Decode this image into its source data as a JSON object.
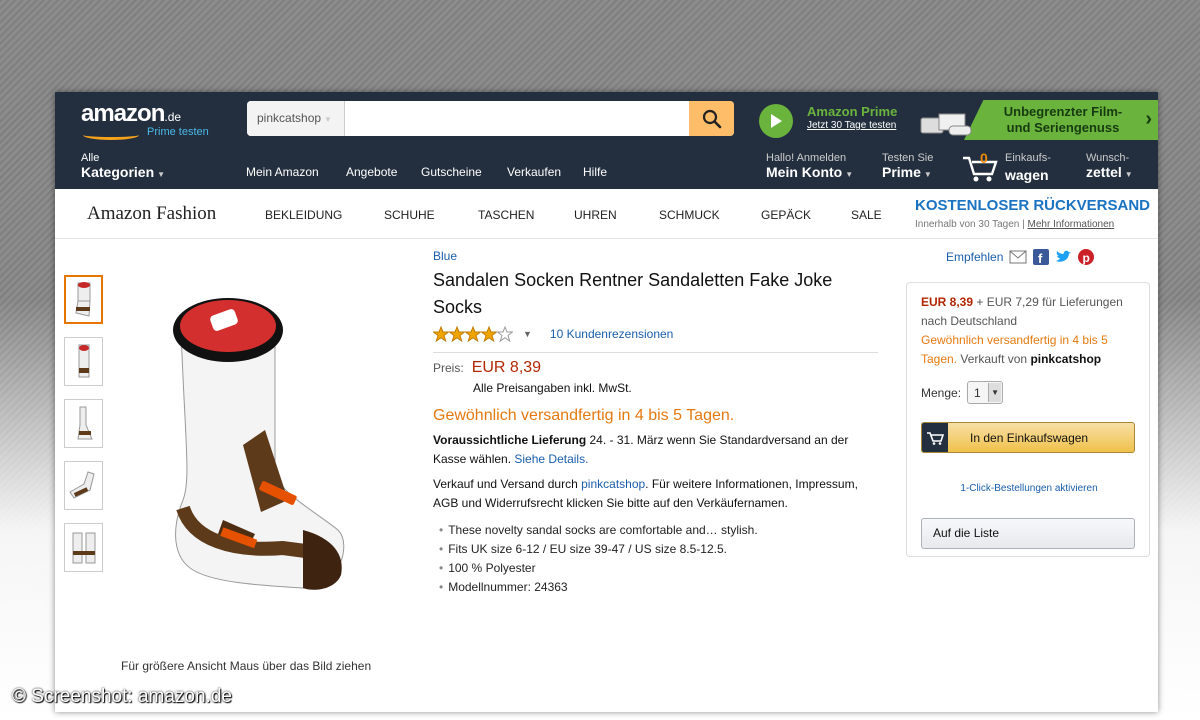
{
  "header": {
    "logo_word": "amazon",
    "logo_tld": ".de",
    "logo_prime_link": "Prime testen",
    "search": {
      "category": "pinkcatshop",
      "value": "",
      "placeholder": ""
    },
    "prime_title": "Amazon Prime",
    "prime_link": "Jetzt 30 Tage testen",
    "banner_text": "Unbegrenzter Film- und Seriengenuss",
    "nav": {
      "all_small": "Alle",
      "all_big": "Kategorien",
      "links": [
        "Mein Amazon",
        "Angebote",
        "Gutscheine",
        "Verkaufen",
        "Hilfe"
      ],
      "account_small": "Hallo! Anmelden",
      "account_big": "Mein Konto",
      "prime_small": "Testen Sie",
      "prime_big": "Prime",
      "cart_count": "0",
      "cart_small": "Einkaufs-",
      "cart_big": "wagen",
      "wish_small": "Wunsch-",
      "wish_big": "zettel"
    }
  },
  "fashion": {
    "brand": "Amazon Fashion",
    "items": [
      "BEKLEIDUNG",
      "SCHUHE",
      "TASCHEN",
      "UHREN",
      "SCHMUCK",
      "GEPÄCK",
      "SALE"
    ],
    "return_title": "KOSTENLOSER RÜCKVERSAND",
    "return_sub": "Innerhalb von 30 Tagen",
    "return_link": "Mehr Informationen"
  },
  "gallery": {
    "caption": "Für größere Ansicht Maus über das Bild ziehen"
  },
  "product": {
    "brand": "Blue",
    "title": "Sandalen Socken Rentner Sandaletten Fake Joke Socks",
    "rating": 4,
    "reviews": "10 Kundenrezensionen",
    "price_label": "Preis:",
    "price": "EUR 8,39",
    "price_note": "Alle Preisangaben inkl. MwSt.",
    "availability": "Gewöhnlich versandfertig in 4 bis 5 Tagen.",
    "delivery_bold": "Voraussichtliche Lieferung",
    "delivery_text": "24. - 31. März wenn Sie Standardversand an der Kasse wählen.",
    "delivery_link": "Siehe Details.",
    "seller_pre": "Verkauf und Versand durch",
    "seller": "pinkcatshop",
    "seller_post": ". Für weitere Informationen, Impressum, AGB und Widerrufsrecht klicken Sie bitte auf den Verkäufernamen.",
    "bullets": [
      "These novelty sandal socks are comfortable and… stylish.",
      "Fits UK size 6-12 / EU size 39-47 / US size 8.5-12.5.",
      "100 % Polyester",
      "Modellnummer: 24363"
    ]
  },
  "buybox": {
    "share_label": "Empfehlen",
    "price": "EUR 8,39",
    "shipping": "+ EUR 7,29 für Lieferungen nach Deutschland",
    "availability": "Gewöhnlich versandfertig in 4 bis 5 Tagen.",
    "sold_by_pre": "Verkauft von",
    "sold_by": "pinkcatshop",
    "qty_label": "Menge:",
    "qty": "1",
    "cart_button": "In den Einkaufswagen",
    "one_click": "1-Click-Bestellungen aktivieren",
    "wishlist_button": "Auf die Liste"
  },
  "watermark": "© Screenshot: amazon.de",
  "colors": {
    "header_bg": "#232f3e",
    "price": "#b12704",
    "availability": "#e47911",
    "link": "#1a5eaa",
    "prime_green": "#6ab43e"
  }
}
